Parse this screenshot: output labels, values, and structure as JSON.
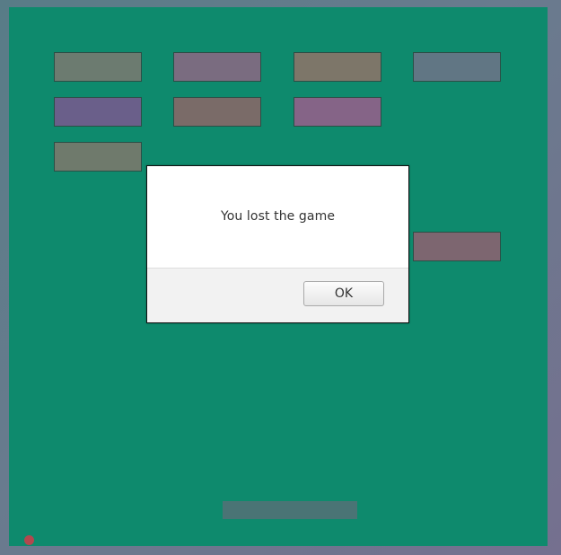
{
  "dialog": {
    "message": "You lost the game",
    "ok_label": "OK"
  },
  "colors": {
    "background_gradient": [
      "#587c87",
      "#697b8e",
      "#75708f"
    ],
    "board": "#0e8a6d",
    "paddle": "#4a7475",
    "ball": "#b2484e",
    "bricks": [
      "#6c7b70",
      "#7a6c80",
      "#7d7669",
      "#617684",
      "#6a5f8a",
      "#7a6b68",
      "#856487",
      "#6f7a6c",
      "#7d6670"
    ]
  }
}
